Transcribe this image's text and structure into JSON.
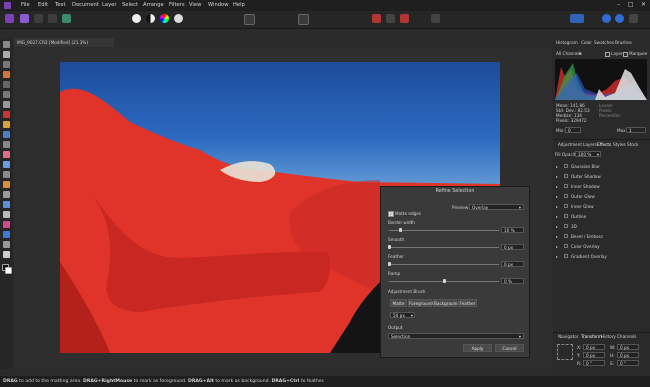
{
  "menu": {
    "items": [
      "File",
      "Edit",
      "Text",
      "Document",
      "Layer",
      "Select",
      "Arrange",
      "Filters",
      "View",
      "Window",
      "Help"
    ]
  },
  "document_tab": "IMG_9027.CR2 [Modified] (21.3%)",
  "refine": {
    "title": "Refine Selection",
    "preview_label": "Preview",
    "preview_value": "Overlay",
    "matte_edges": "Matte edges",
    "border_width_label": "Border width",
    "border_width_value": "10 %",
    "smooth_label": "Smooth",
    "smooth_value": "0 px",
    "feather_label": "Feather",
    "feather_value": "0 px",
    "ramp_label": "Ramp",
    "ramp_value": "0 %",
    "brush_label": "Adjustment Brush",
    "brush_modes": [
      "Matte",
      "Foreground",
      "Background",
      "Feather"
    ],
    "brush_size": "50 px",
    "output_label": "Output",
    "output_value": "Selection",
    "apply_label": "Apply",
    "cancel_label": "Cancel",
    "matte_edges_checked": true,
    "border_width_level": 0.1,
    "smooth_level": 0.0,
    "feather_level": 0.0,
    "ramp_level": 0.5
  },
  "right": {
    "histogram_tabs": [
      "Histogram",
      "Color",
      "Swatches",
      "Brushes"
    ],
    "channel_select": "All Channels",
    "layer_opt": "Layer",
    "marquee_opt": "Marquee",
    "stats_left": [
      "Mean: 141.86",
      "Std. Dev.: 82.53",
      "Median: 134",
      "Pixels: 329472"
    ],
    "stats_right": [
      "Levels:",
      "Pixels:",
      "Percentile:"
    ],
    "min_label": "Min:",
    "min_value": "0",
    "max_label": "Max:",
    "max_value": "1",
    "fx_tabs": [
      "Adjustment",
      "Layers",
      "Effects",
      "Styles",
      "Stock"
    ],
    "fill_opacity_label": "Fill Opacity:",
    "fill_opacity_value": "100 %",
    "effects": [
      "Gaussian Blur",
      "Outer Shadow",
      "Inner Shadow",
      "Outer Glow",
      "Inner Glow",
      "Outline",
      "3D",
      "Bevel / Emboss",
      "Color Overlay",
      "Gradient Overlay"
    ],
    "bottom_tabs": [
      "Navigator",
      "Transform",
      "History",
      "Channels"
    ],
    "transform_fields": [
      "X:",
      "Y:",
      "W:",
      "H:",
      "R:",
      "S:"
    ],
    "transform_values": [
      "0 px",
      "0 px",
      "0 px",
      "0 px",
      "0 °",
      "0 °"
    ]
  },
  "status_text": {
    "s1b": "DRAG",
    "s1": " to add to the matting area. ",
    "s2b": "DRAG+RightMouse",
    "s2": " to mark as foreground. ",
    "s3b": "DRAG+Alt",
    "s3": " to mark as background. ",
    "s4b": "DRAG+Ctrl",
    "s4": " to feather."
  },
  "colors": {
    "overlay_red": "#e0332a",
    "sky_blue": "#2c6bc1",
    "accent": "#5a8ee0"
  }
}
